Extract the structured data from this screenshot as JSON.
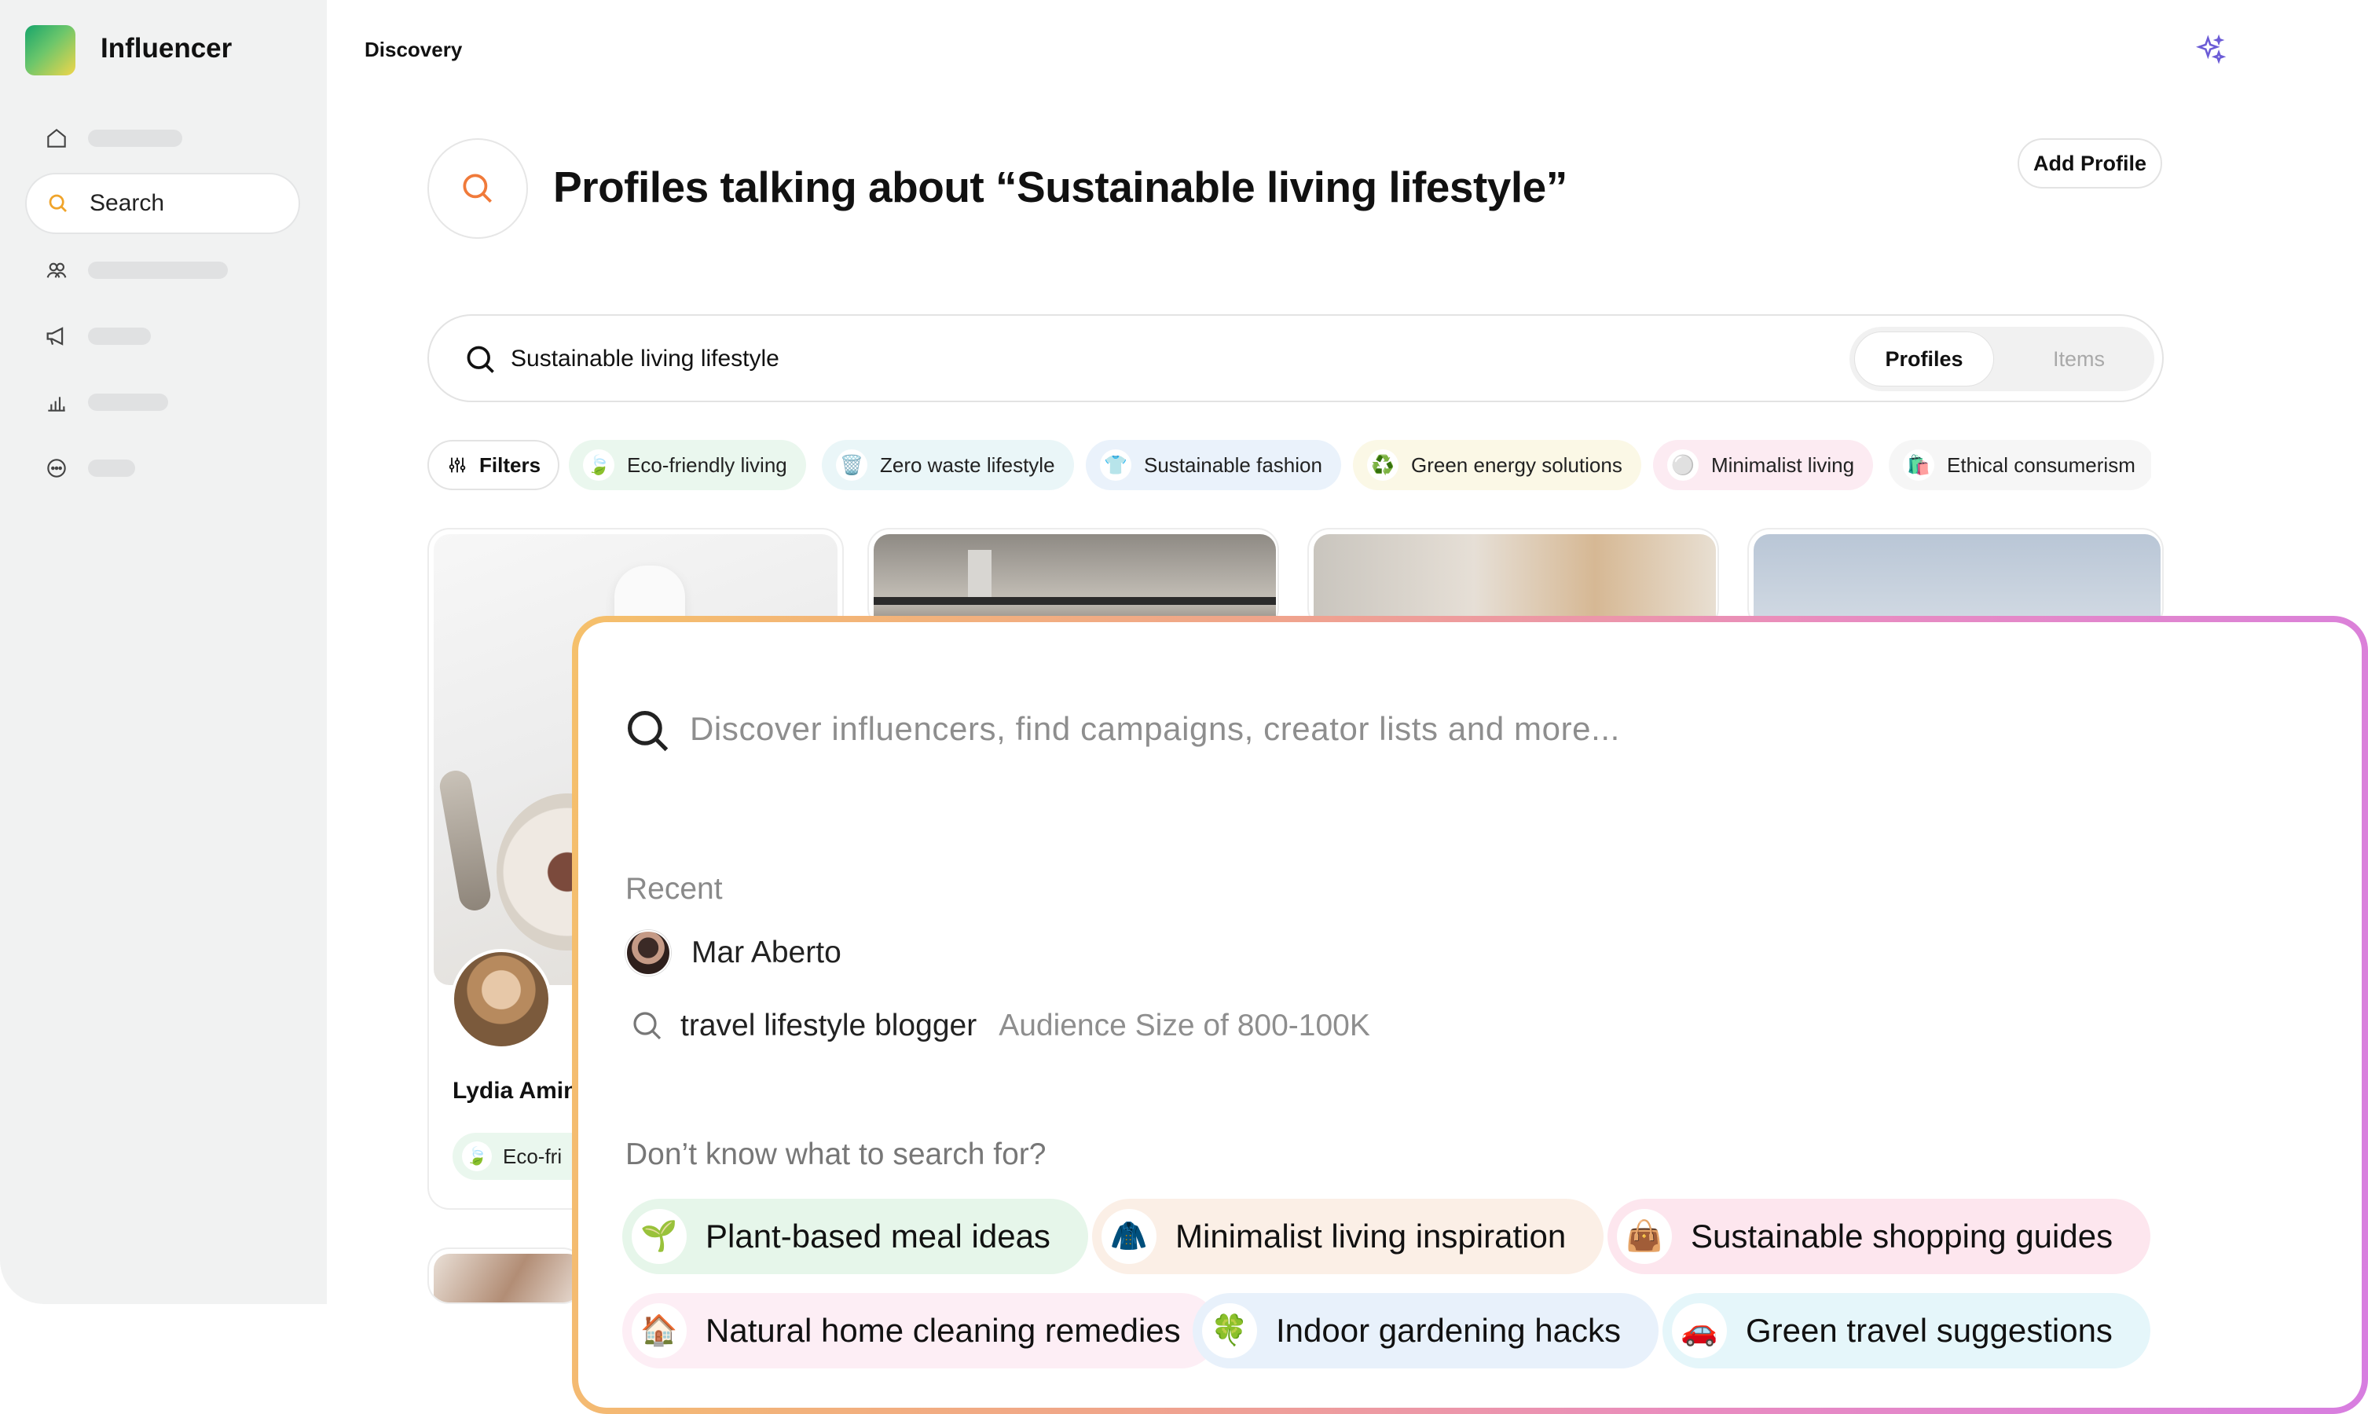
{
  "app": {
    "brand": "Influencer"
  },
  "sidebar": {
    "search_label": "Search",
    "items": [
      {
        "icon": "home-icon"
      },
      {
        "icon": "search-icon",
        "label": "Search"
      },
      {
        "icon": "users-icon"
      },
      {
        "icon": "megaphone-icon"
      },
      {
        "icon": "bar-chart-icon"
      },
      {
        "icon": "chat-icon"
      }
    ]
  },
  "header": {
    "breadcrumb": "Discovery",
    "sparkle_icon": "sparkle-icon"
  },
  "main": {
    "title": "Profiles talking about “Sustainable living lifestyle”",
    "add_profile": "Add Profile",
    "search_value": "Sustainable living lifestyle",
    "segments": [
      "Profiles",
      "Items"
    ],
    "filters_label": "Filters",
    "chips": [
      {
        "label": "Eco-friendly living",
        "emoji": "🍃",
        "color": "#eaf7ee"
      },
      {
        "label": "Zero waste lifestyle",
        "emoji": "🗑️",
        "color": "#eaf6f8"
      },
      {
        "label": "Sustainable fashion",
        "emoji": "👕",
        "color": "#eaf2fb"
      },
      {
        "label": "Green energy solutions",
        "emoji": "♻️",
        "color": "#fbf8e6"
      },
      {
        "label": "Minimalist living",
        "emoji": "⚪",
        "color": "#fcebf2"
      },
      {
        "label": "Ethical consumerism",
        "emoji": "🛍️",
        "color": "#f6f6f6"
      }
    ],
    "card": {
      "name": "Lydia Amin",
      "tag": "Eco-fri"
    }
  },
  "overlay": {
    "placeholder": "Discover influencers, find campaigns, creator lists and more...",
    "recent_heading": "Recent",
    "recent": [
      {
        "type": "profile",
        "text": "Mar Aberto"
      },
      {
        "type": "query",
        "text": "travel lifestyle blogger",
        "sub": "Audience Size of 800-100K"
      }
    ],
    "suggest_heading": "Don’t know what to search for?",
    "suggestions": [
      {
        "label": "Plant-based meal ideas",
        "emoji": "🌱",
        "color": "#e6f6ea"
      },
      {
        "label": "Minimalist living inspiration",
        "emoji": "🧥",
        "color": "#fbefe6"
      },
      {
        "label": "Sustainable shopping guides",
        "emoji": "👜",
        "color": "#fde6ee"
      },
      {
        "label": "Natural home cleaning remedies",
        "emoji": "🏠",
        "color": "#fdeef5"
      },
      {
        "label": "Indoor gardening hacks",
        "emoji": "🍀",
        "color": "#e8f1fb"
      },
      {
        "label": "Green travel suggestions",
        "emoji": "🚗",
        "color": "#e5f6fa"
      }
    ]
  }
}
